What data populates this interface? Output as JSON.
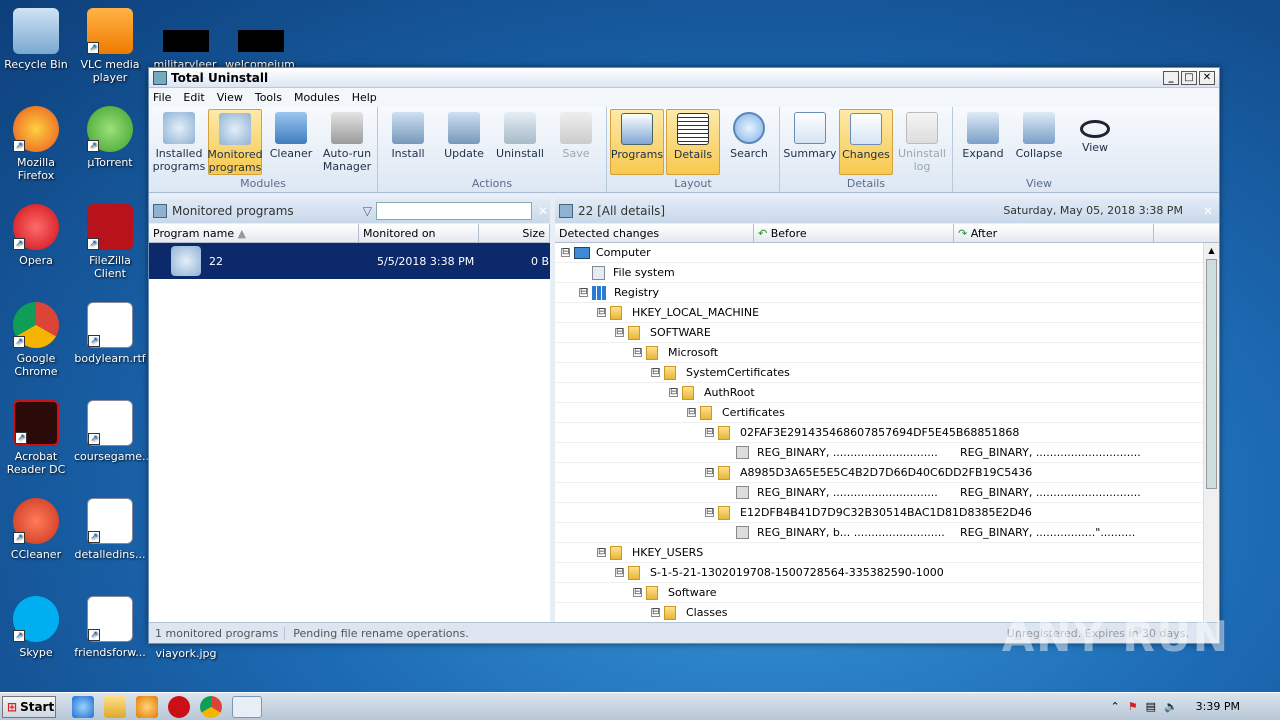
{
  "desktop": {
    "icons": [
      {
        "label": "Recycle Bin"
      },
      {
        "label": "VLC media player"
      },
      {
        "label": "Mozilla Firefox"
      },
      {
        "label": "µTorrent"
      },
      {
        "label": "Opera"
      },
      {
        "label": "FileZilla Client"
      },
      {
        "label": "Google Chrome"
      },
      {
        "label": "bodylearn.rtf"
      },
      {
        "label": "Acrobat Reader DC"
      },
      {
        "label": "coursegame..."
      },
      {
        "label": "CCleaner"
      },
      {
        "label": "detalledins..."
      },
      {
        "label": "Skype"
      },
      {
        "label": "friendsforw..."
      }
    ],
    "partial_labels": [
      "militaryleer",
      "welcomeium",
      "viayork.jpg"
    ]
  },
  "window": {
    "title": "Total Uninstall",
    "controls": [
      "_",
      "□",
      "✕"
    ]
  },
  "menu": [
    "File",
    "Edit",
    "View",
    "Tools",
    "Modules",
    "Help"
  ],
  "ribbon": {
    "groups": [
      {
        "label": "Modules",
        "buttons": [
          {
            "label": "Installed programs",
            "active": false
          },
          {
            "label": "Monitored programs",
            "active": true
          },
          {
            "label": "Cleaner",
            "active": false
          },
          {
            "label": "Auto-run Manager",
            "active": false
          }
        ]
      },
      {
        "label": "Actions",
        "buttons": [
          {
            "label": "Install",
            "active": false
          },
          {
            "label": "Update",
            "active": false
          },
          {
            "label": "Uninstall",
            "active": false
          },
          {
            "label": "Save",
            "active": false,
            "disabled": true
          }
        ]
      },
      {
        "label": "Layout",
        "buttons": [
          {
            "label": "Programs",
            "active": true
          },
          {
            "label": "Details",
            "active": true
          },
          {
            "label": "Search",
            "active": false
          }
        ]
      },
      {
        "label": "Details",
        "buttons": [
          {
            "label": "Summary",
            "active": false
          },
          {
            "label": "Changes",
            "active": true
          },
          {
            "label": "Uninstall log",
            "active": false,
            "disabled": true
          }
        ]
      },
      {
        "label": "View",
        "buttons": [
          {
            "label": "Expand",
            "active": false
          },
          {
            "label": "Collapse",
            "active": false
          },
          {
            "label": "View",
            "active": false
          }
        ]
      }
    ]
  },
  "left_pane": {
    "title": "Monitored programs",
    "filter_value": "",
    "columns": [
      "Program name",
      "Monitored on",
      "Size"
    ],
    "rows": [
      {
        "name": "22",
        "monitored_on": "5/5/2018 3:38 PM",
        "size": "0 B"
      }
    ]
  },
  "right_pane": {
    "title": "22 [All details]",
    "date": "Saturday, May 05, 2018 3:38 PM",
    "columns": [
      "Detected changes",
      "Before",
      "After"
    ],
    "tree": [
      {
        "indent": 0,
        "label": "Computer",
        "kind": "computer",
        "toggle": "⊟"
      },
      {
        "indent": 1,
        "label": "File system",
        "kind": "file",
        "toggle": ""
      },
      {
        "indent": 1,
        "label": "Registry",
        "kind": "registry",
        "toggle": "⊟"
      },
      {
        "indent": 2,
        "label": "HKEY_LOCAL_MACHINE",
        "kind": "folder",
        "toggle": "⊟"
      },
      {
        "indent": 3,
        "label": "SOFTWARE",
        "kind": "folder",
        "toggle": "⊟"
      },
      {
        "indent": 4,
        "label": "Microsoft",
        "kind": "folder",
        "toggle": "⊟"
      },
      {
        "indent": 5,
        "label": "SystemCertificates",
        "kind": "folder",
        "toggle": "⊟"
      },
      {
        "indent": 6,
        "label": "AuthRoot",
        "kind": "folder",
        "toggle": "⊟"
      },
      {
        "indent": 7,
        "label": "Certificates",
        "kind": "folder",
        "toggle": "⊟"
      },
      {
        "indent": 8,
        "label": "02FAF3E291435468607857694DF5E45B68851868",
        "kind": "folder",
        "toggle": "⊟"
      },
      {
        "indent": 9,
        "label": "REG_BINARY, ..............................",
        "kind": "value",
        "toggle": "",
        "before": "REG_BINARY, ..............................",
        "after": ""
      },
      {
        "indent": 8,
        "label": "A8985D3A65E5E5C4B2D7D66D40C6DD2FB19C5436",
        "kind": "folder",
        "toggle": "⊟"
      },
      {
        "indent": 9,
        "label": "REG_BINARY, ..............................",
        "kind": "value",
        "toggle": "",
        "before": "REG_BINARY, ..............................",
        "after": ""
      },
      {
        "indent": 8,
        "label": "E12DFB4B41D7D9C32B30514BAC1D81D8385E2D46",
        "kind": "folder",
        "toggle": "⊟"
      },
      {
        "indent": 9,
        "label": "REG_BINARY, b... ..........................",
        "kind": "value",
        "toggle": "",
        "before": "REG_BINARY, .................\"..........",
        "after": ""
      },
      {
        "indent": 2,
        "label": "HKEY_USERS",
        "kind": "folder",
        "toggle": "⊟"
      },
      {
        "indent": 3,
        "label": "S-1-5-21-1302019708-1500728564-335382590-1000",
        "kind": "folder",
        "toggle": "⊟"
      },
      {
        "indent": 4,
        "label": "Software",
        "kind": "folder",
        "toggle": "⊟"
      },
      {
        "indent": 5,
        "label": "Classes",
        "kind": "folder",
        "toggle": "⊟"
      }
    ]
  },
  "status": {
    "count": "1 monitored programs",
    "message": "Pending file rename operations.",
    "registration": "Unregistered. Expires in 30 days."
  },
  "taskbar": {
    "start_label": "Start",
    "clock": "3:39 PM"
  },
  "watermark": "ANY RUN"
}
